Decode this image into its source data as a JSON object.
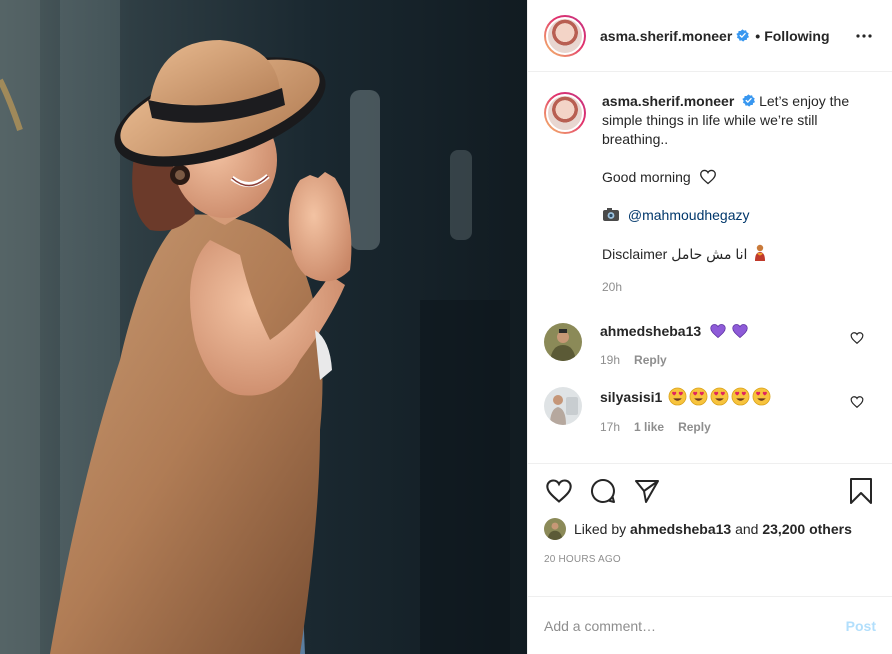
{
  "header": {
    "username": "asma.sherif.moneer",
    "separator": "•",
    "follow_state": "Following"
  },
  "caption": {
    "username": "asma.sherif.moneer",
    "text": "Let’s enjoy the simple things in life while we’re still breathing..",
    "line2": "Good morning",
    "credit": "@mahmoudhegazy",
    "disclaimer": "Disclaimer انا مش حامل",
    "time": "20h"
  },
  "comments": [
    {
      "username": "ahmedsheba13",
      "time": "19h",
      "reply": "Reply",
      "emoji": [
        "purple-heart",
        "purple-heart"
      ]
    },
    {
      "username": "silyasisi1",
      "time": "17h",
      "likes": "1 like",
      "reply": "Reply",
      "emoji": [
        "heart-eyes",
        "heart-eyes",
        "heart-eyes",
        "heart-eyes",
        "heart-eyes"
      ]
    }
  ],
  "likes": {
    "prefix": "Liked by",
    "user": "ahmedsheba13",
    "middle": "and",
    "others": "23,200 others"
  },
  "timestamp": "20 HOURS AGO",
  "add_comment": {
    "placeholder": "Add a comment…",
    "post_label": "Post"
  },
  "colors": {
    "verified": "#3897f0",
    "link": "#00376b",
    "post_disabled": "#b2dffc",
    "purple_heart": "#8e5bd8",
    "muted": "#8e8e8e"
  },
  "icons": [
    "verified-badge-icon",
    "more-options-icon",
    "heart-outline-icon",
    "comment-icon",
    "share-icon",
    "bookmark-icon",
    "camera-emoji-icon",
    "white-heart-emoji-icon",
    "woman-emoji-icon"
  ]
}
